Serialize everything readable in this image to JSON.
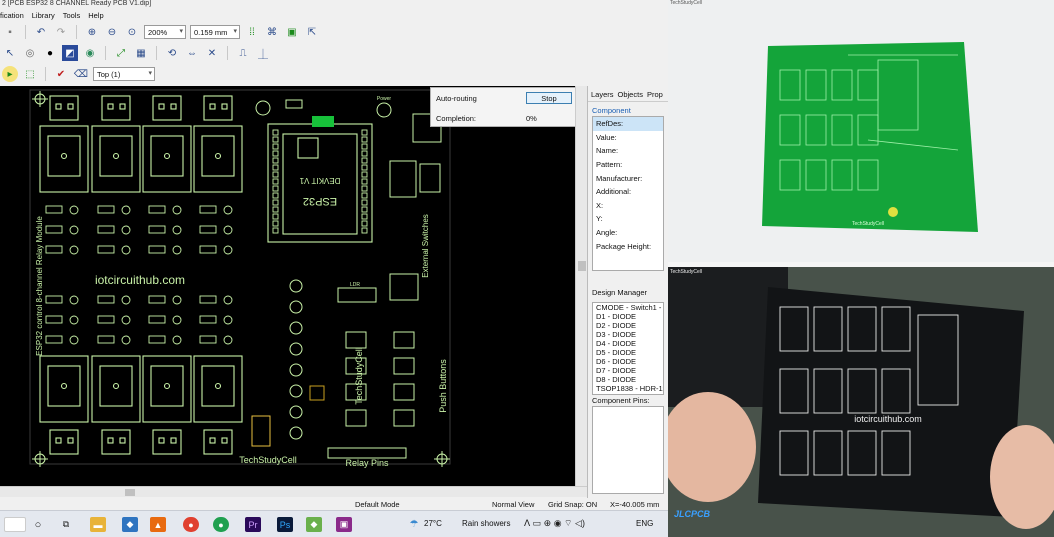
{
  "window": {
    "title": "2 [PCB ESP32 8 CHANNEL Ready PCB V1.dip]"
  },
  "menu": [
    "fication",
    "Library",
    "Tools",
    "Help"
  ],
  "toolbar": {
    "zoom": "200%",
    "grid": "0.159 mm",
    "layer": "Top (1)"
  },
  "autorouting": {
    "label": "Auto-routing",
    "stop": "Stop",
    "completion_label": "Completion:",
    "completion_value": "0%"
  },
  "panel": {
    "tabs": [
      "Layers",
      "Objects",
      "Prop"
    ],
    "section": "Component",
    "props": [
      "RefDes:",
      "Value:",
      "Name:",
      "Pattern:",
      "Manufacturer:",
      "Additional:",
      "X:",
      "Y:",
      "Angle:",
      "Package Height:"
    ],
    "dm_title": "Design Manager",
    "dm_items": [
      "CMODE - Switch1 - B",
      "D1 - DIODE",
      "D2 - DIODE",
      "D3 - DIODE",
      "D4 - DIODE",
      "D5 - DIODE",
      "D6 - DIODE",
      "D7 - DIODE",
      "D8 - DIODE",
      "TSOP1838 - HDR-1x"
    ],
    "pins_title": "Component Pins:"
  },
  "status": {
    "mode": "Default Mode",
    "view": "Normal View",
    "snap": "Grid Snap: ON",
    "coords": "X=-40.005 mm"
  },
  "pcb": {
    "brand": "TechStudyCell",
    "url": "iotcircuithub.com",
    "module_name": "ESP32 control 8-channel Relay Module",
    "esp_label": "ESP32",
    "devkit_label": "DEVKIT V1",
    "ext_switches": "External Switches",
    "push_buttons": "Push Buttons",
    "relay_pins": "Relay Pins",
    "power_label": "Power",
    "ldr_label": "LDR"
  },
  "taskbar": {
    "weather_temp": "27°C",
    "weather_text": "Rain showers",
    "lang": "ENG"
  },
  "photos": {
    "top_caption": "TechStudyCell",
    "bottom_badge": "JLCPCB"
  },
  "colors": {
    "pcb_bg": "#000000",
    "silk": "#c9f2a8",
    "board_green": "#14a43a",
    "accent_blue": "#3c7fb1"
  }
}
